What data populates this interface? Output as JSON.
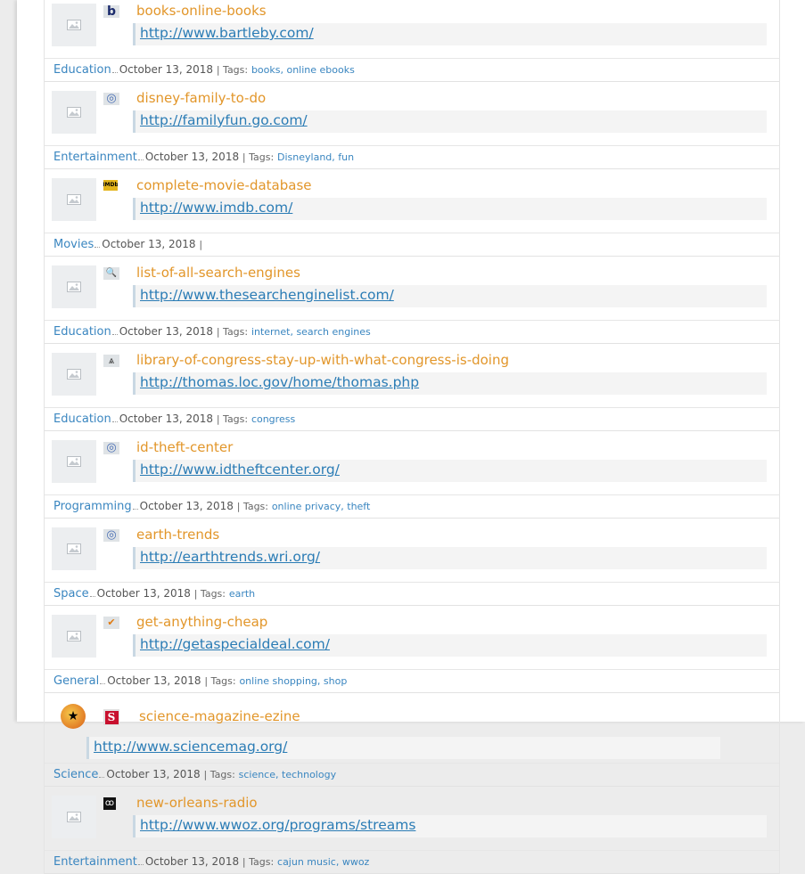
{
  "entries": [
    {
      "title": "books-online-books",
      "url": "http://www.bartleby.com/",
      "category": "Education",
      "date": "October 13, 2018",
      "tags_label": "| Tags:",
      "tags": [
        "books",
        "online ebooks"
      ],
      "favicon": "bartleby-b-icon"
    },
    {
      "title": "disney-family-to-do",
      "url": "http://familyfun.go.com/",
      "category": "Entertainment",
      "date": "October 13, 2018",
      "tags_label": "| Tags:",
      "tags": [
        "Disneyland",
        "fun"
      ],
      "favicon": "globe-icon"
    },
    {
      "title": "complete-movie-database",
      "url": "http://www.imdb.com/",
      "category": "Movies",
      "date": "October 13, 2018",
      "tags_label": "|",
      "tags": [],
      "favicon": "imdb-icon"
    },
    {
      "title": "list-of-all-search-engines",
      "url": "http://www.thesearchenginelist.com/",
      "category": "Education",
      "date": "October 13, 2018",
      "tags_label": "| Tags:",
      "tags": [
        "internet",
        "search engines"
      ],
      "favicon": "magnifier-icon"
    },
    {
      "title": "library-of-congress-stay-up-with-what-congress-is-doing",
      "url": "http://thomas.loc.gov/home/thomas.php",
      "category": "Education",
      "date": "October 13, 2018",
      "tags_label": "| Tags:",
      "tags": [
        "congress"
      ],
      "favicon": "capitol-icon"
    },
    {
      "title": "id-theft-center",
      "url": "http://www.idtheftcenter.org/",
      "category": "Programming",
      "date": "October 13, 2018",
      "tags_label": "| Tags:",
      "tags": [
        "online privacy",
        "theft"
      ],
      "favicon": "globe-icon"
    },
    {
      "title": "earth-trends",
      "url": "http://earthtrends.wri.org/",
      "category": "Space",
      "date": "October 13, 2018",
      "tags_label": "| Tags:",
      "tags": [
        "earth"
      ],
      "favicon": "globe-icon"
    },
    {
      "title": "get-anything-cheap",
      "url": "http://getaspecialdeal.com/",
      "category": "General",
      "date": "October 13, 2018",
      "tags_label": "| Tags:",
      "tags": [
        "online shopping",
        "shop"
      ],
      "favicon": "checkmark-icon"
    },
    {
      "title": "science-magazine-ezine",
      "url": "http://www.sciencemag.org/",
      "category": "Science",
      "date": "October 13, 2018",
      "tags_label": "| Tags:",
      "tags": [
        "science",
        "technology"
      ],
      "favicon": "science-s-icon",
      "special": true
    },
    {
      "title": "new-orleans-radio",
      "url": "http://www.wwoz.org/programs/streams",
      "category": "Entertainment",
      "date": "October 13, 2018",
      "tags_label": "| Tags:",
      "tags": [
        "cajun music",
        "wwoz"
      ],
      "favicon": "wwoz-icon"
    }
  ],
  "favicon_glyphs": {
    "bartleby-b-icon": "b",
    "globe-icon": "◎",
    "imdb-icon": "IMDb",
    "magnifier-icon": "🔍",
    "capitol-icon": "⩓",
    "checkmark-icon": "✔",
    "wwoz-icon": "ꝏ",
    "science-s-icon": "S"
  },
  "colors": {
    "title": "#e2962a",
    "link": "#2b7cb5",
    "category": "#3a86c0"
  }
}
